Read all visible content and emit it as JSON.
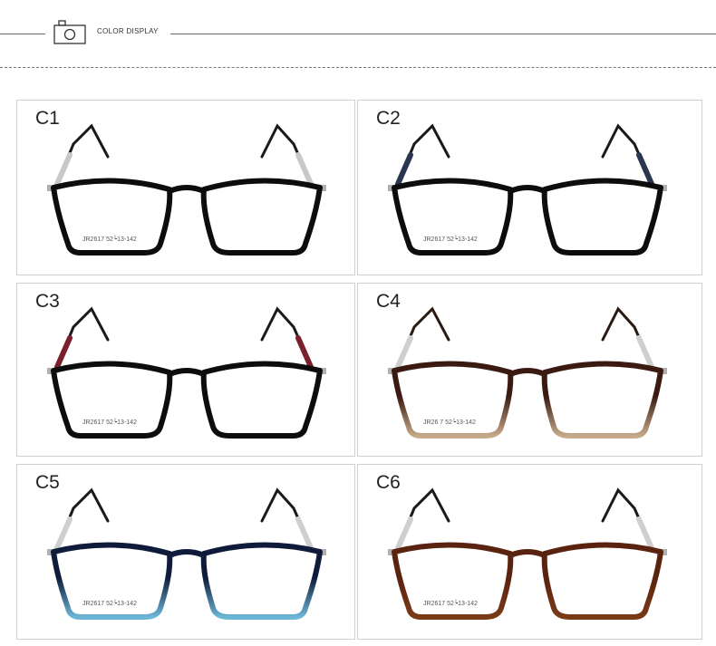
{
  "header": {
    "title": "COLOR DISPLAY",
    "icon": "camera-icon"
  },
  "colors": {
    "frame_outline": "#111111",
    "hinge": "#b0b0b0"
  },
  "variants": [
    {
      "label": "C1",
      "top": "#0d0d0d",
      "bottom": "#0d0d0d",
      "temple": "#1a1a1a",
      "sleeve": "#c8c8c8",
      "imprint": "JR2617  52┕13-142"
    },
    {
      "label": "C2",
      "top": "#0d0d0d",
      "bottom": "#0d0d0d",
      "temple": "#1a1a1a",
      "sleeve": "#2a3550",
      "imprint": "JR2617  52┕13-142"
    },
    {
      "label": "C3",
      "top": "#0d0d0d",
      "bottom": "#0d0d0d",
      "temple": "#1a1a1a",
      "sleeve": "#7a1f2b",
      "imprint": "JR2617  52┕13-142"
    },
    {
      "label": "C4",
      "top": "#3b1a12",
      "bottom": "#c6a98a",
      "temple": "#2a1a14",
      "sleeve": "#cfcfcf",
      "imprint": "JR26 7  52┕13-142"
    },
    {
      "label": "C5",
      "top": "#101a3a",
      "bottom": "#6bb6d6",
      "temple": "#1a1a1a",
      "sleeve": "#cfcfcf",
      "imprint": "JR2617  52┕13-142"
    },
    {
      "label": "C6",
      "top": "#5a2310",
      "bottom": "#7a3a16",
      "temple": "#1a1a1a",
      "sleeve": "#cfcfcf",
      "imprint": "JR2617  52┕13-142"
    }
  ]
}
